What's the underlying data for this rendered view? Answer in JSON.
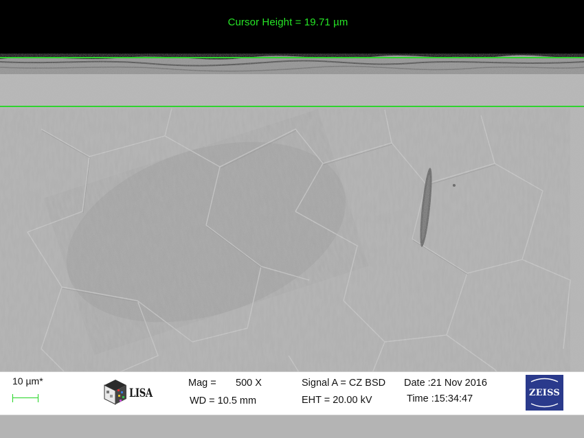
{
  "measurement": {
    "cursor_readout": "Cursor Height = 19.71 µm"
  },
  "databar": {
    "scale_label": "10 µm*",
    "logo_lisa_text": "LISA",
    "mag_label": "Mag =",
    "mag_value": "500 X",
    "wd": "WD = 10.5 mm",
    "signal": "Signal A = CZ BSD",
    "eht": "EHT = 20.00 kV",
    "date": "Date :21 Nov 2016",
    "time": "Time :15:34:47",
    "logo_zeiss_text": "ZEISS"
  },
  "colors": {
    "cursor_green": "#2ed42e",
    "zeiss_blue": "#2a3a8c",
    "specimen_gray": "#b5b5b5"
  },
  "icons": {
    "lisa_logo": "lisa-cube-logo",
    "zeiss_logo": "zeiss-logo"
  }
}
